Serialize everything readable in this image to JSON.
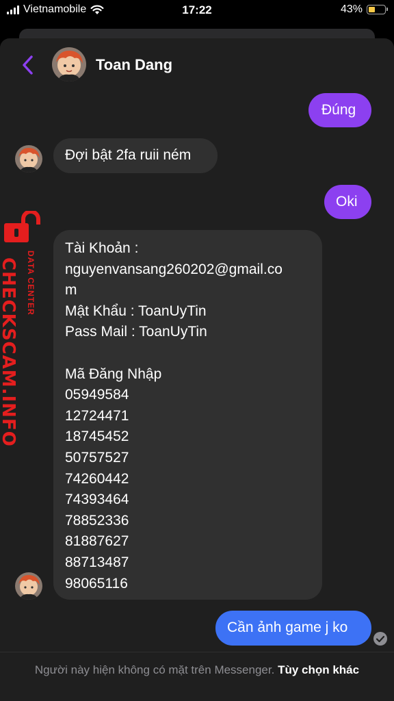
{
  "status_bar": {
    "carrier": "Vietnamobile",
    "time": "17:22",
    "battery_percent": "43%",
    "battery_level": 0.43,
    "battery_color": "#f7c948"
  },
  "header": {
    "contact_name": "Toan Dang",
    "back_icon": "chevron-left-icon",
    "accent_color": "#8c40f0"
  },
  "messages": [
    {
      "direction": "outgoing",
      "color": "#8c40f0",
      "lines": [
        "Đúng"
      ]
    },
    {
      "direction": "incoming",
      "lines": [
        "Đợi bật 2fa ruii ném"
      ]
    },
    {
      "direction": "outgoing",
      "color": "#8c40f0",
      "lines": [
        "Oki"
      ]
    },
    {
      "direction": "incoming",
      "lines": [
        "Tài Khoản :",
        "nguyenvansang260202@gmail.co",
        "m",
        "Mật Khẩu : ToanUyTin",
        "Pass Mail : ToanUyTin",
        "",
        "Mã Đăng Nhập",
        "05949584",
        "12724471",
        "18745452",
        "50757527",
        "74260442",
        "74393464",
        "78852336",
        "81887627",
        "88713487",
        "98065116"
      ]
    },
    {
      "direction": "outgoing",
      "color": "#3d72f5",
      "lines": [
        "Cần ảnh game j ko"
      ]
    }
  ],
  "watermark": {
    "main": "CHECKSCAM.INFO",
    "sub": "DATA CENTER",
    "icon": "lock-icon",
    "color": "#e41e1e"
  },
  "footer": {
    "note": "Người này hiện không có mặt trên Messenger.",
    "link": "Tùy chọn khác"
  }
}
